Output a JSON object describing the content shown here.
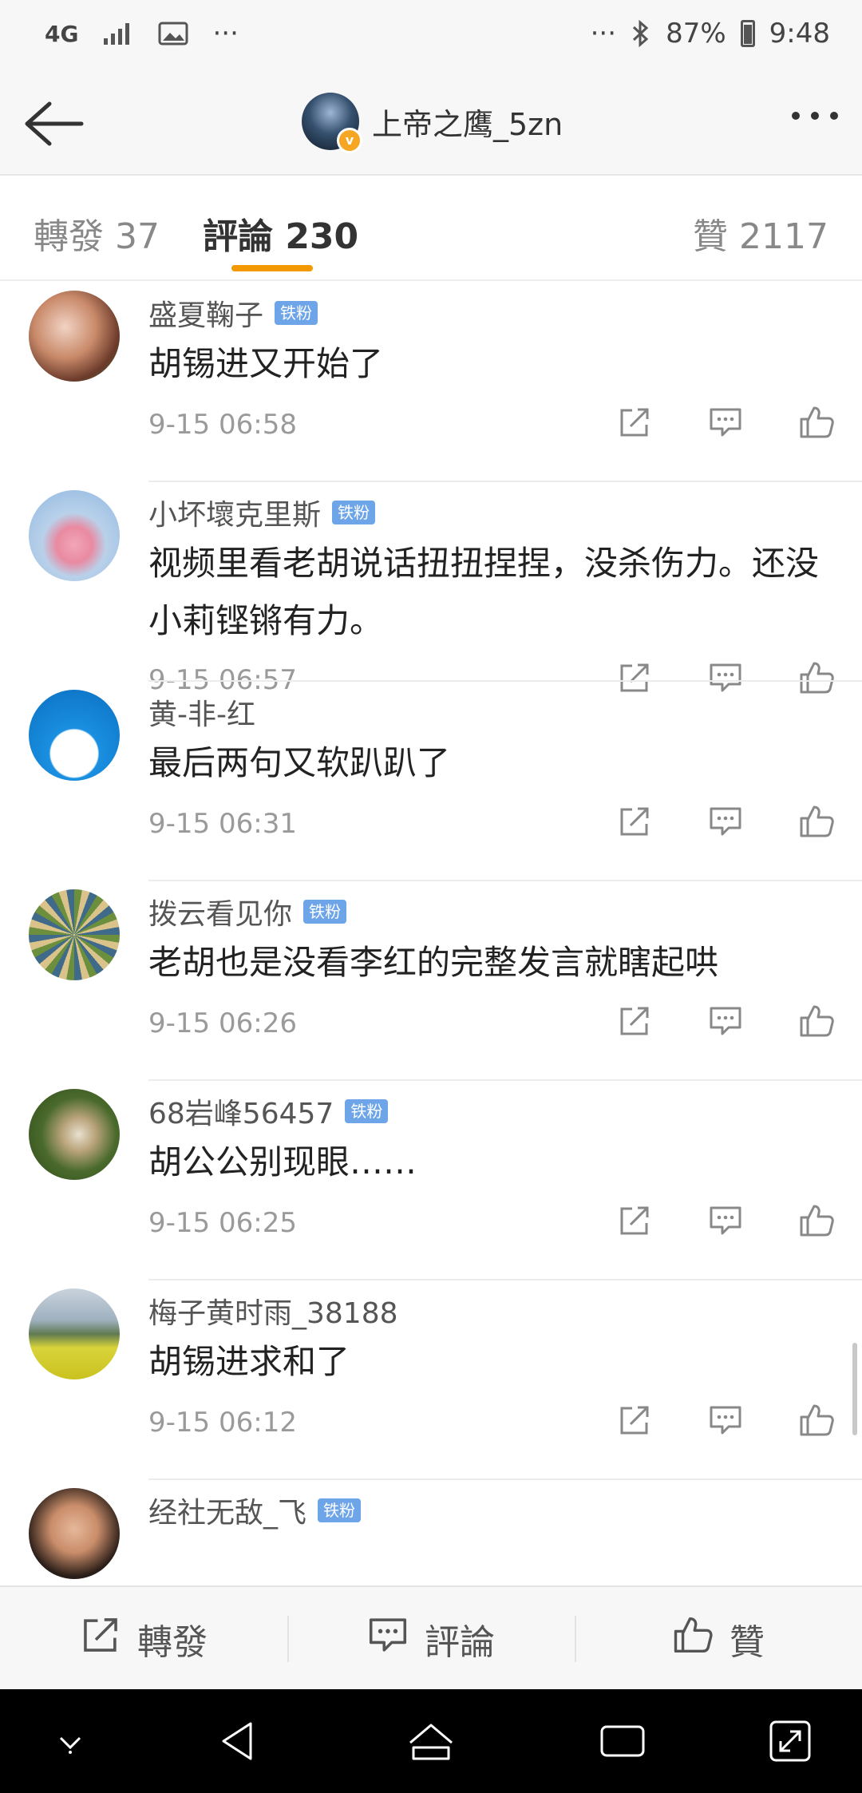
{
  "status_bar": {
    "network": "4G",
    "ellipsis_left": "···",
    "ellipsis_right": "···",
    "battery": "87%",
    "time": "9:48"
  },
  "header": {
    "title": "上帝之鹰_5zn"
  },
  "tabs": [
    {
      "label": "轉發 37"
    },
    {
      "label": "評論 230"
    },
    {
      "label": "贊 2117"
    }
  ],
  "fan_badge": "铁粉",
  "comments": [
    {
      "name": "盛夏鞠子",
      "badge": true,
      "text": "胡锡进又开始了",
      "time": "9-15 06:58"
    },
    {
      "name": "小坏壞克里斯",
      "badge": true,
      "text": "视频里看老胡说话扭扭捏捏，没杀伤力。还没小莉铿锵有力。",
      "time": "9-15 06:57"
    },
    {
      "name": "黄-非-红",
      "badge": false,
      "text": "最后两句又软趴趴了",
      "time": "9-15 06:31"
    },
    {
      "name": "拨云看见你",
      "badge": true,
      "text": "老胡也是没看李红的完整发言就瞎起哄",
      "time": "9-15 06:26"
    },
    {
      "name": "68岩峰56457",
      "badge": true,
      "text": "胡公公别现眼……",
      "time": "9-15 06:25"
    },
    {
      "name": "梅子黄时雨_38188",
      "badge": false,
      "text": "胡锡进求和了",
      "time": "9-15 06:12"
    },
    {
      "name": "经社无敌_飞",
      "badge": true,
      "text": "",
      "time": ""
    }
  ],
  "bottom_bar": {
    "repost": "轉發",
    "comment": "評論",
    "like": "贊"
  }
}
